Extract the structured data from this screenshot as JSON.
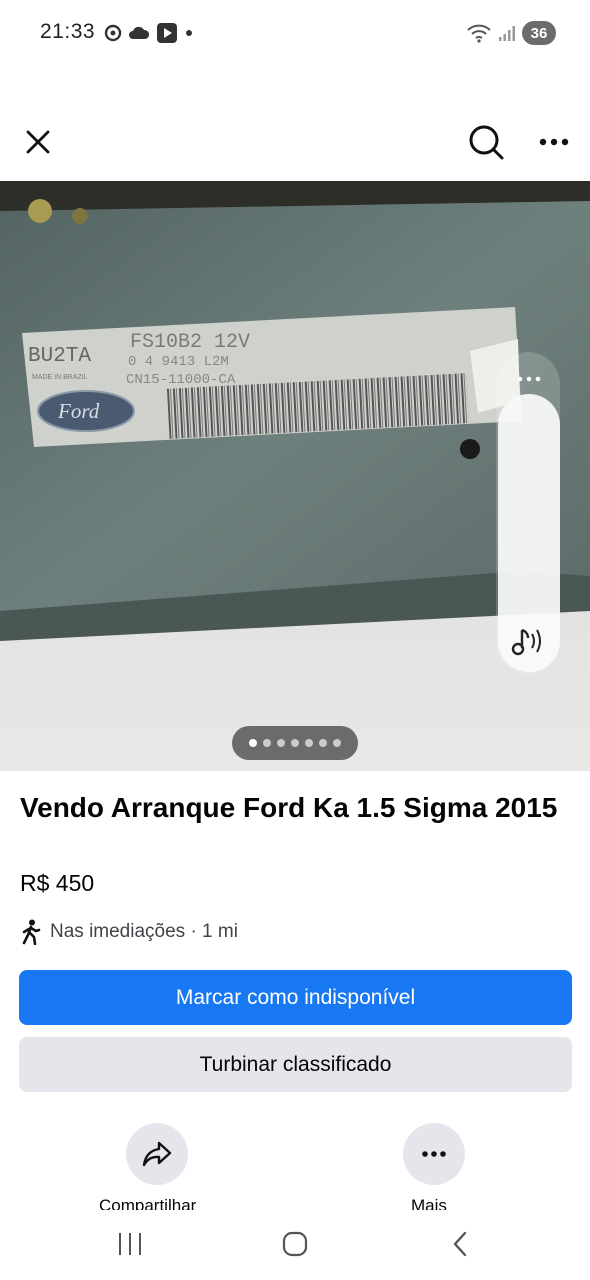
{
  "status": {
    "time": "21:33",
    "battery": "36",
    "left_icons": [
      "chrome-icon",
      "cloud-icon",
      "play-icon",
      "dot-icon"
    ],
    "right_icons": [
      "wifi-icon",
      "signal-icon"
    ]
  },
  "toolbar": {
    "close_icon": "close-icon",
    "search_icon": "search-icon",
    "more_icon": "more-icon"
  },
  "photo": {
    "label_text": {
      "line1": "BU2TA",
      "code": "FS10B2 12V",
      "small1": "MADE IN BRAZIL",
      "serial1": "0  4 9413 L2M",
      "serial2": "CN15-11000-CA",
      "brand": "Ford"
    },
    "pager": {
      "count": 7,
      "active": 0
    },
    "side_panel_icon": "music-note-icon"
  },
  "listing": {
    "title": "Vendo Arranque Ford Ka 1.5 Sigma 2015",
    "price": "R$ 450",
    "location": "Nas imediações · 1 mi"
  },
  "buttons": {
    "primary": "Marcar como indisponível",
    "secondary": "Turbinar classificado"
  },
  "actions": [
    {
      "label": "Compartilhar",
      "icon": "share-icon"
    },
    {
      "label": "Mais",
      "icon": "more-icon"
    }
  ],
  "colors": {
    "primary": "#1877f2",
    "secondary": "#e4e6eb"
  }
}
